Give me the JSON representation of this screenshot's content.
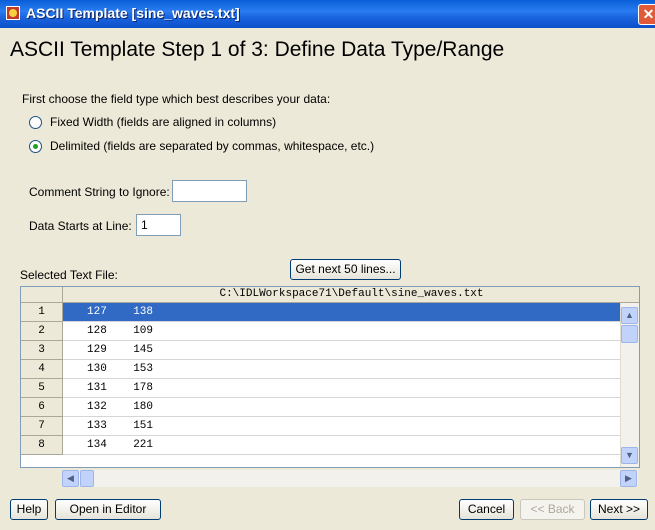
{
  "window": {
    "title": "ASCII Template [sine_waves.txt]",
    "close_glyph": "✕"
  },
  "heading": "ASCII Template Step 1 of 3: Define Data Type/Range",
  "field_type": {
    "prompt": "First choose the field type which best describes your data:",
    "options": [
      {
        "label": "Fixed Width  (fields are aligned in columns)",
        "checked": false
      },
      {
        "label": "Delimited  (fields are separated by commas, whitespace, etc.)",
        "checked": true
      }
    ]
  },
  "comment": {
    "label": "Comment String to Ignore:",
    "value": ""
  },
  "data_start": {
    "label": "Data Starts at Line:",
    "value": "1"
  },
  "selected_file_label": "Selected Text File:",
  "get_next_button": "Get next 50 lines...",
  "table": {
    "column_header": "C:\\IDLWorkspace71\\Default\\sine_waves.txt",
    "rows": [
      {
        "num": "1",
        "text": "127    138",
        "selected": true
      },
      {
        "num": "2",
        "text": "128    109"
      },
      {
        "num": "3",
        "text": "129    145"
      },
      {
        "num": "4",
        "text": "130    153"
      },
      {
        "num": "5",
        "text": "131    178"
      },
      {
        "num": "6",
        "text": "132    180"
      },
      {
        "num": "7",
        "text": "133    151"
      },
      {
        "num": "8",
        "text": "134    221"
      }
    ]
  },
  "buttons": {
    "help": "Help",
    "open_editor": "Open in Editor",
    "cancel": "Cancel",
    "back": "<< Back",
    "next": "Next >>"
  },
  "scroll": {
    "up": "▲",
    "down": "▼",
    "left": "◀",
    "right": "▶"
  },
  "colors": {
    "selection": "#316ac5",
    "titlebar": "#0a5fd8",
    "radio_dot": "#21a121"
  }
}
